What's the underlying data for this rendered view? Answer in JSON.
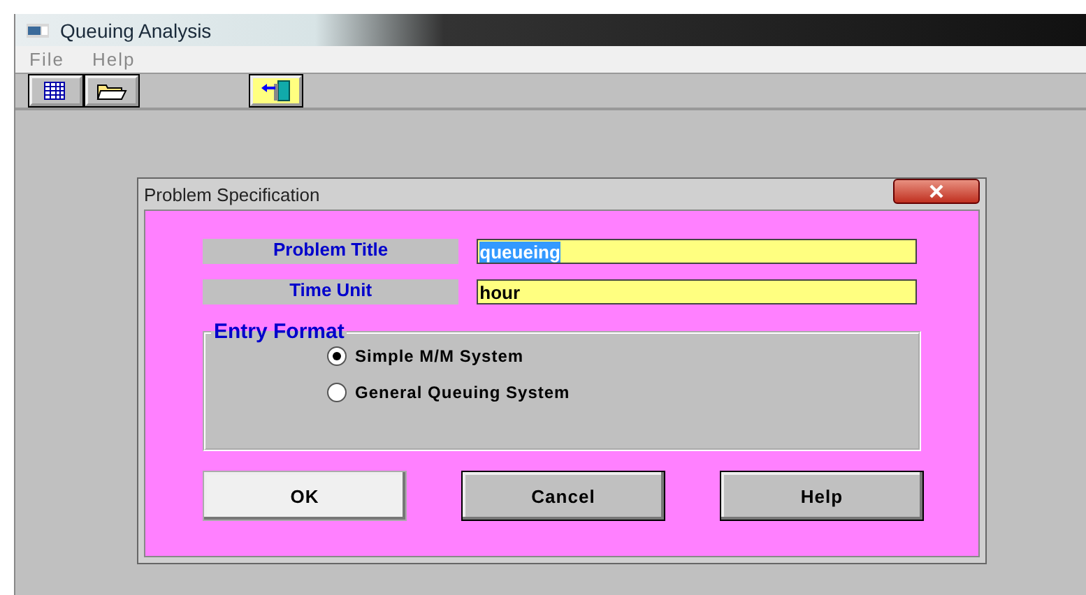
{
  "window": {
    "title": "Queuing Analysis"
  },
  "menu": [
    {
      "label": "File"
    },
    {
      "label": "Help"
    }
  ],
  "dialog": {
    "title": "Problem Specification",
    "fields": [
      {
        "label": "Problem Title",
        "value": "queueing",
        "text_selected": true
      },
      {
        "label": "Time Unit",
        "value": "hour",
        "text_selected": false
      }
    ],
    "group": {
      "title": "Entry Format",
      "options": [
        {
          "label": "Simple M/M System",
          "selected": true
        },
        {
          "label": "General Queuing System",
          "selected": false
        }
      ]
    },
    "buttons": [
      {
        "label": "OK",
        "focused": true
      },
      {
        "label": "Cancel",
        "focused": false
      },
      {
        "label": "Help",
        "focused": false
      }
    ]
  }
}
